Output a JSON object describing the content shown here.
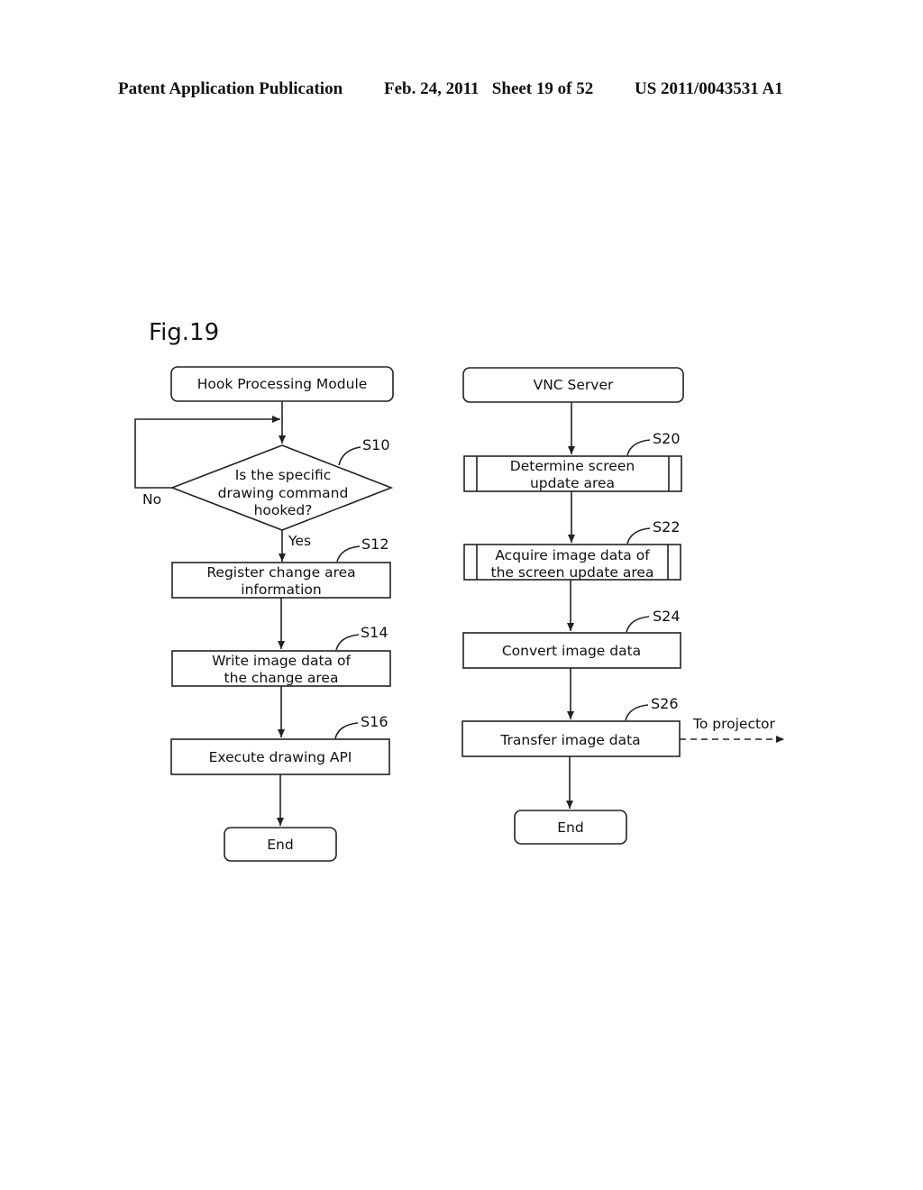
{
  "header": {
    "publication": "Patent Application Publication",
    "date_sheet": "Feb. 24, 2011   Sheet 19 of 52",
    "number": "US 2011/0043531 A1"
  },
  "figure": {
    "title": "Fig.19",
    "left_flow": {
      "start": "Hook Processing Module",
      "decision": {
        "step": "S10",
        "lines": [
          "Is the specific",
          "drawing command",
          "hooked?"
        ],
        "no_label": "No",
        "yes_label": "Yes"
      },
      "steps": [
        {
          "id": "S12",
          "lines": [
            "Register change area",
            "information"
          ]
        },
        {
          "id": "S14",
          "lines": [
            "Write image data of",
            "the change area"
          ]
        },
        {
          "id": "S16",
          "lines": [
            "Execute drawing API"
          ]
        }
      ],
      "end": "End"
    },
    "right_flow": {
      "start": "VNC Server",
      "steps": [
        {
          "id": "S20",
          "lines": [
            "Determine screen",
            "update area"
          ],
          "type": "predefined-process"
        },
        {
          "id": "S22",
          "lines": [
            "Acquire image data of",
            "the screen update area"
          ],
          "type": "predefined-process"
        },
        {
          "id": "S24",
          "lines": [
            "Convert image data"
          ],
          "type": "process"
        },
        {
          "id": "S26",
          "lines": [
            "Transfer image data"
          ],
          "type": "process"
        }
      ],
      "output_label": "To projector",
      "end": "End"
    }
  }
}
